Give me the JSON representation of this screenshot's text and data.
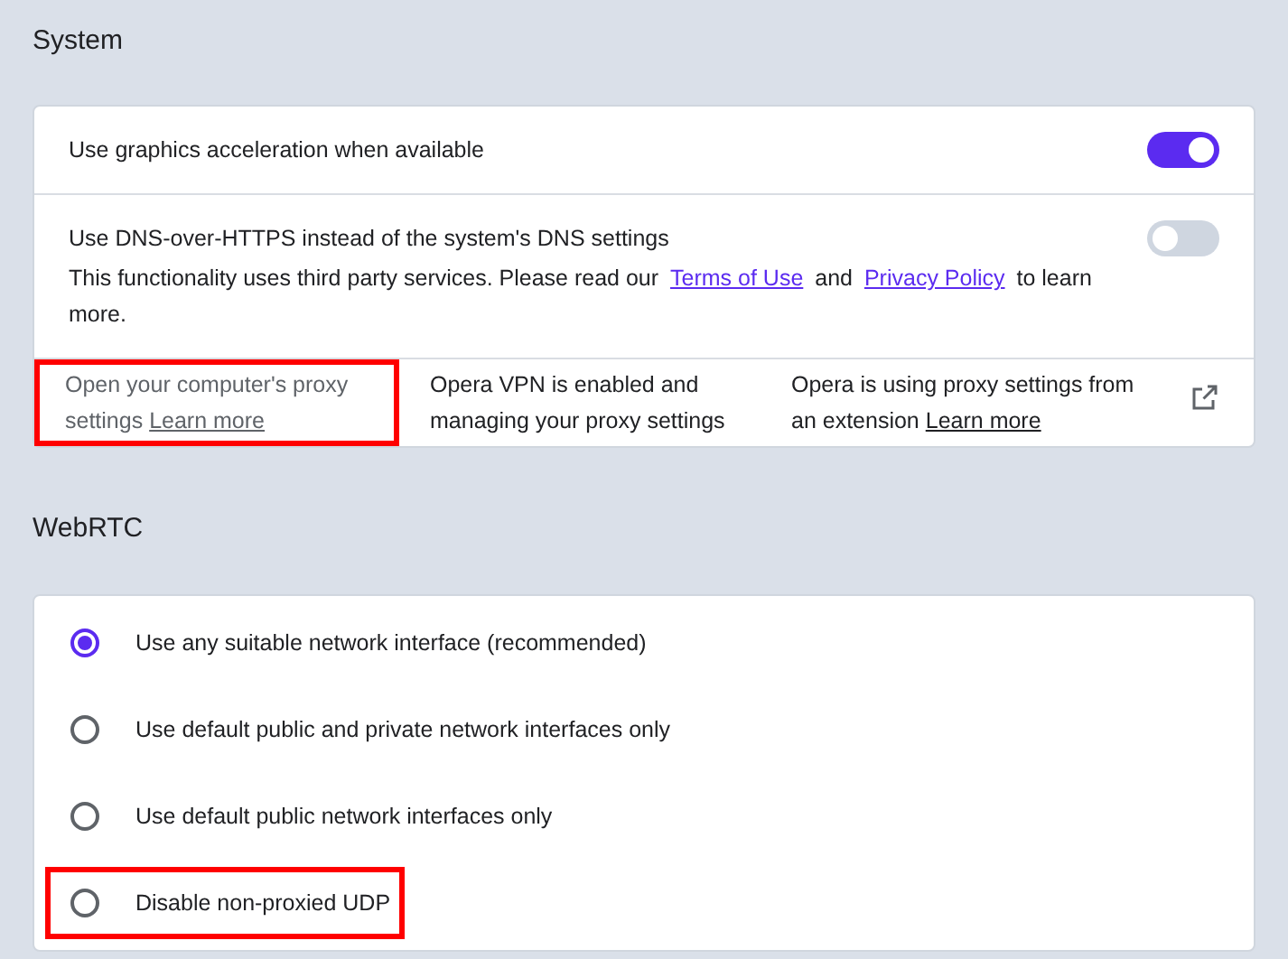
{
  "system": {
    "title": "System",
    "toggles": [
      {
        "label": "Use graphics acceleration when available",
        "on": true
      },
      {
        "label": "Use DNS-over-HTTPS instead of the system's DNS settings",
        "on": false,
        "description": [
          {
            "kind": "text",
            "text": "This functionality uses third party services. Please read our "
          },
          {
            "kind": "link",
            "text": "Terms of Use"
          },
          {
            "kind": "text",
            "text": " and "
          },
          {
            "kind": "link",
            "text": "Privacy Policy"
          },
          {
            "kind": "text",
            "text": " to learn more."
          }
        ]
      }
    ],
    "proxy": [
      {
        "text": "Open your computer's proxy settings",
        "link": "Learn more",
        "disabled": true,
        "highlighted": true
      },
      {
        "text": "Opera VPN is enabled and managing your proxy settings",
        "disabled": false,
        "highlighted": false
      },
      {
        "text": "Opera is using proxy settings from an extension",
        "link": "Learn more",
        "disabled": false,
        "highlighted": false
      }
    ]
  },
  "webrtc": {
    "title": "WebRTC",
    "options": [
      {
        "label": "Use any suitable network interface (recommended)",
        "selected": true,
        "highlighted": false
      },
      {
        "label": "Use default public and private network interfaces only",
        "selected": false,
        "highlighted": false
      },
      {
        "label": "Use default public network interfaces only",
        "selected": false,
        "highlighted": false
      },
      {
        "label": "Disable non-proxied UDP",
        "selected": false,
        "highlighted": true
      }
    ]
  }
}
